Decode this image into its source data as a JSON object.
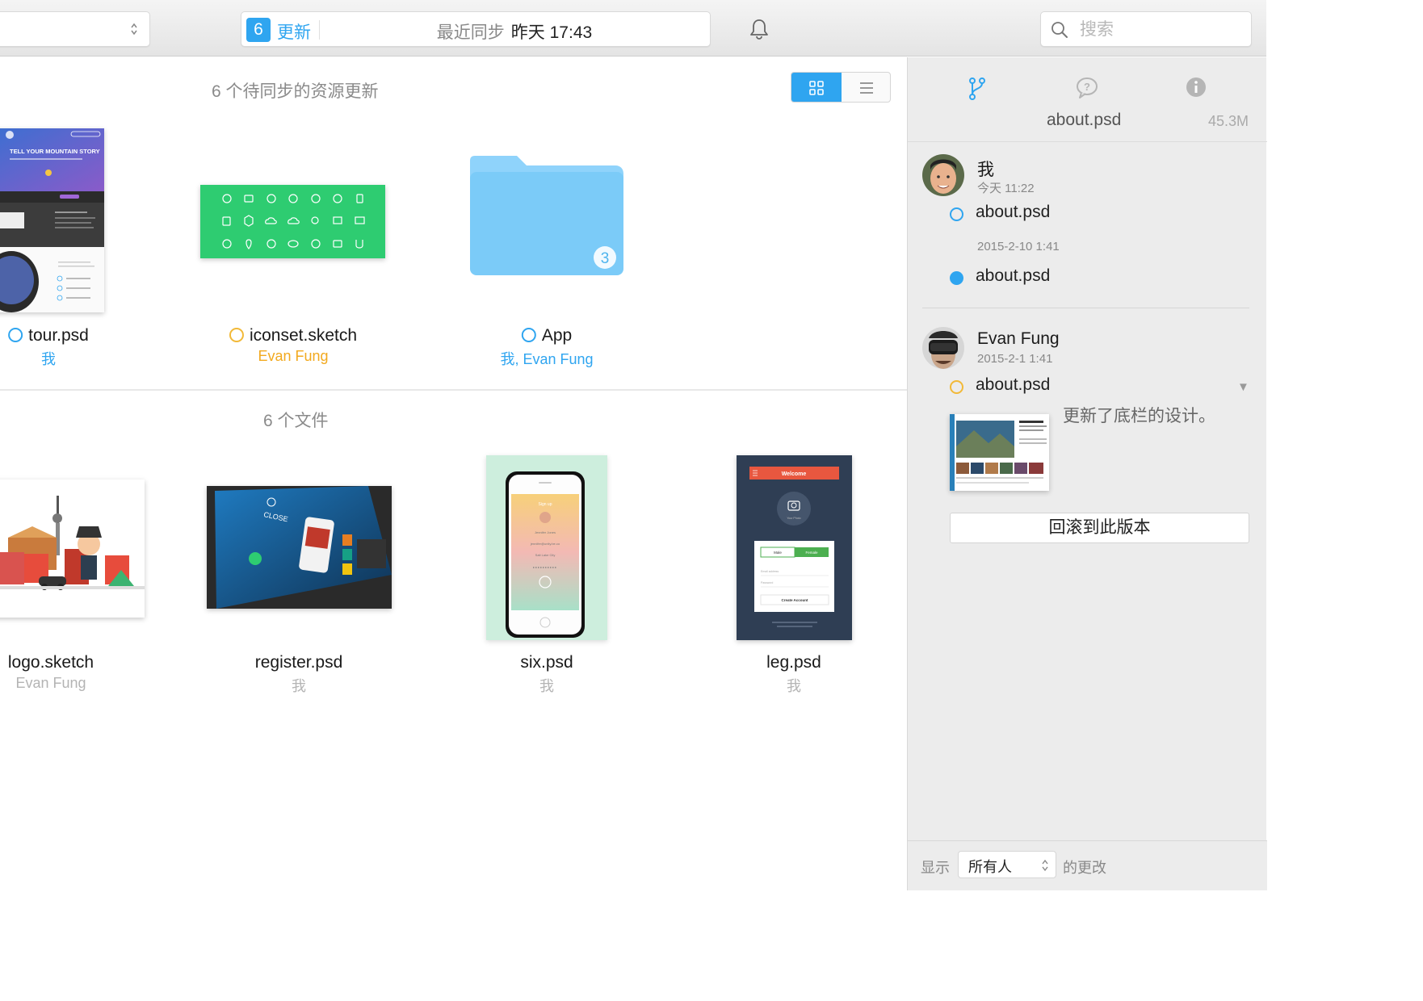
{
  "toolbar": {
    "update_count": "6",
    "update_label": "更新",
    "sync_prefix": "最近同步",
    "sync_time": "昨天 17:43",
    "search_placeholder": "搜索"
  },
  "main": {
    "pending_title": "6 个待同步的资源更新",
    "files_title": "6 个文件",
    "pending_items": [
      {
        "name": "tour.psd",
        "owner": "我",
        "status": "blue"
      },
      {
        "name": "iconset.sketch",
        "owner": "Evan Fung",
        "status": "orange"
      },
      {
        "name": "App",
        "owner": "我, Evan Fung",
        "status": "blue",
        "folder_count": "3"
      }
    ],
    "files": [
      {
        "name": "logo.sketch",
        "owner": "Evan Fung"
      },
      {
        "name": "register.psd",
        "owner": "我"
      },
      {
        "name": "six.psd",
        "owner": "我"
      },
      {
        "name": "leg.psd",
        "owner": "我"
      }
    ],
    "tour_thumb": {
      "headline": "TELL YOUR MOUNTAIN STORY"
    },
    "leg_thumb": {
      "header": "Welcome",
      "photo_label": "Your Photo",
      "male": "Male",
      "female": "Female",
      "email": "Email address",
      "password": "Password",
      "button": "Create Account"
    },
    "six_thumb": {
      "signup": "Sign up",
      "name": "Jennifer Jones",
      "email": "jennifer@unity.be.co",
      "city": "Salt Lake City"
    },
    "register_thumb": {
      "close": "CLOSE"
    }
  },
  "sidebar": {
    "file_name": "about.psd",
    "file_size": "45.3M",
    "versions": [
      {
        "author": "我",
        "time": "今天 11:22",
        "entries": [
          {
            "file": "about.psd",
            "status": "hollow-blue"
          },
          {
            "time": "2015-2-10 1:41",
            "file": "about.psd",
            "status": "filled-blue"
          }
        ]
      },
      {
        "author": "Evan Fung",
        "time": "2015-2-1 1:41",
        "entries": [
          {
            "file": "about.psd",
            "status": "hollow-orange",
            "comment": "更新了底栏的设计。"
          }
        ]
      }
    ],
    "rollback_label": "回滚到此版本",
    "footer": {
      "show_label": "显示",
      "filter_value": "所有人",
      "changes_label": "的更改"
    }
  },
  "colors": {
    "accent": "#2fa5f0",
    "pending_orange": "#f2b938",
    "iconset_green": "#2ecc71"
  }
}
